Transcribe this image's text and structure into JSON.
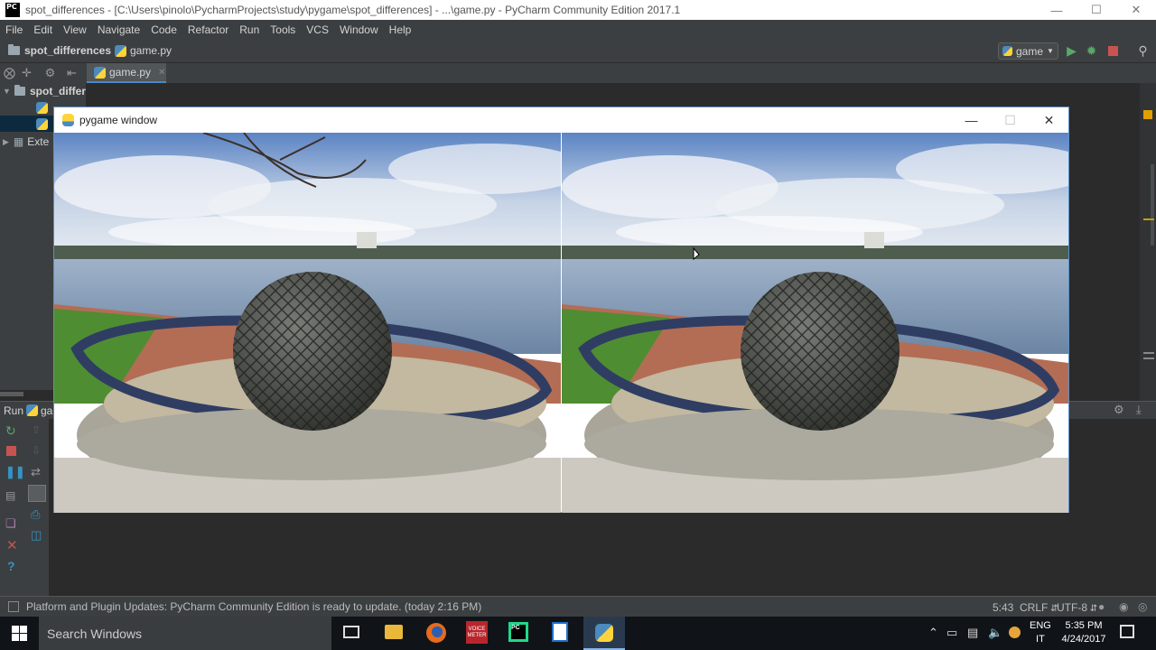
{
  "window": {
    "title": "spot_differences - [C:\\Users\\pinolo\\PycharmProjects\\study\\pygame\\spot_differences] - ...\\game.py - PyCharm Community Edition 2017.1",
    "logo_text": "PC"
  },
  "menu": [
    "File",
    "Edit",
    "View",
    "Navigate",
    "Code",
    "Refactor",
    "Run",
    "Tools",
    "VCS",
    "Window",
    "Help"
  ],
  "navbar": {
    "project": "spot_differences",
    "file": "game.py",
    "run_config": "game"
  },
  "editor_tabs": [
    {
      "label": "game.py"
    }
  ],
  "project_tree": {
    "root": "spot_differ",
    "external": "Exte"
  },
  "run_panel": {
    "label": "Run",
    "config": "ga"
  },
  "pygame_window": {
    "title": "pygame window"
  },
  "status": {
    "message": "Platform and Plugin Updates: PyCharm Community Edition is ready to update. (today 2:16 PM)",
    "position": "5:43",
    "line_sep": "CRLF",
    "encoding": "UTF-8"
  },
  "taskbar": {
    "search_placeholder": "Search Windows",
    "lang_1": "ENG",
    "lang_2": "IT",
    "time": "5:35 PM",
    "date": "4/24/2017",
    "voice_app_label": "VOICE METER"
  }
}
